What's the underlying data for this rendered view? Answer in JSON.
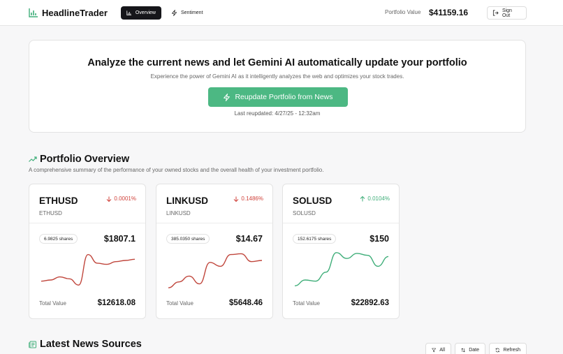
{
  "header": {
    "app_title": "HeadlineTrader",
    "nav": {
      "overview": "Overview",
      "sentiment": "Sentiment"
    },
    "portfolio_value_label": "Portfolio Value",
    "portfolio_value": "$41159.16",
    "sign_out": "Sign Out"
  },
  "hero": {
    "title": "Analyze the current news and let Gemini AI automatically update your portfolio",
    "subtitle": "Experience the power of Gemini AI as it intelligently analyzes the web and optimizes your stock trades.",
    "button": "Reupdate Portfolio from News",
    "last_updated": "Last reupdated: 4/27/25 - 12:32am"
  },
  "overview": {
    "title": "Portfolio Overview",
    "subtitle": "A comprehensive summary of the performance of your owned stocks and the overall health of your investment portfolio.",
    "total_value_label": "Total Value",
    "stocks": [
      {
        "symbol": "ETHUSD",
        "name": "ETHUSD",
        "change": "0.0001%",
        "direction": "down",
        "shares": "6.9825 shares",
        "price": "$1807.1",
        "total_value": "$12618.08",
        "color": "#c0463c",
        "trend": [
          0.22,
          0.25,
          0.33,
          0.28,
          0.12,
          0.9,
          0.68,
          0.65,
          0.72,
          0.75,
          0.78
        ]
      },
      {
        "symbol": "LINKUSD",
        "name": "LINKUSD",
        "change": "0.1486%",
        "direction": "down",
        "shares": "385.0350 shares",
        "price": "$14.67",
        "total_value": "$5648.46",
        "color": "#c0463c",
        "trend": [
          0.05,
          0.2,
          0.35,
          0.15,
          0.7,
          0.6,
          0.9,
          0.92,
          0.72,
          0.75
        ]
      },
      {
        "symbol": "SOLUSD",
        "name": "SOLUSD",
        "change": "0.0104%",
        "direction": "up",
        "shares": "152.6175 shares",
        "price": "$150",
        "total_value": "$22892.63",
        "color": "#3fae79",
        "trend": [
          0.1,
          0.25,
          0.22,
          0.45,
          0.95,
          0.8,
          0.93,
          0.88,
          0.6,
          0.85
        ]
      }
    ]
  },
  "news": {
    "title": "Latest News Sources",
    "filter_all": "All",
    "sort_date": "Date",
    "refresh": "Refresh"
  }
}
